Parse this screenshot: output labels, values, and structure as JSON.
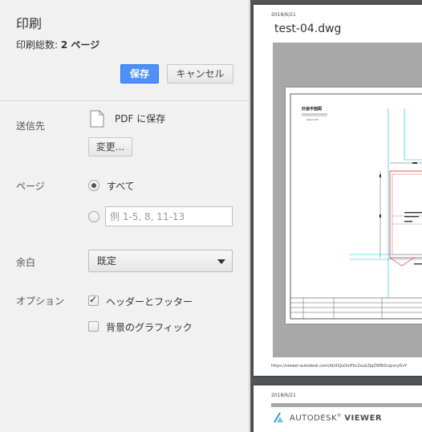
{
  "dialog": {
    "title": "印刷",
    "summary_label": "印刷総数:",
    "summary_value": "2 ページ",
    "save_label": "保存",
    "cancel_label": "キャンセル"
  },
  "destination": {
    "label": "送信先",
    "value": "PDF に保存",
    "change_label": "変更..."
  },
  "pages": {
    "label": "ページ",
    "all_label": "すべて",
    "all_selected": true,
    "custom_placeholder": "例 1-5, 8, 11-13",
    "custom_value": ""
  },
  "margins": {
    "label": "余白",
    "selected": "既定"
  },
  "options": {
    "label": "オプション",
    "items": [
      {
        "label": "ヘッダーとフッター",
        "checked": true
      },
      {
        "label": "背景のグラフィック",
        "checked": false
      }
    ]
  },
  "preview": {
    "page1_date": "2018/6/21",
    "page1_title": "test-04.dwg",
    "drawing_title": "計画平面図",
    "page1_url": "https://viewer.autodesk.com/id/dXJuOmFkc2sub2JqZWN0czpvcy5vY",
    "page2_date": "2018/6/21",
    "logo_text_a": "AUTODESK",
    "logo_text_b": "VIEWER",
    "logo_color": "#1f8acb"
  },
  "colors": {
    "accent": "#4d90fe",
    "preview_bg": "#525659",
    "cad_cyan": "#00c0e0",
    "cad_red": "#e03030"
  }
}
